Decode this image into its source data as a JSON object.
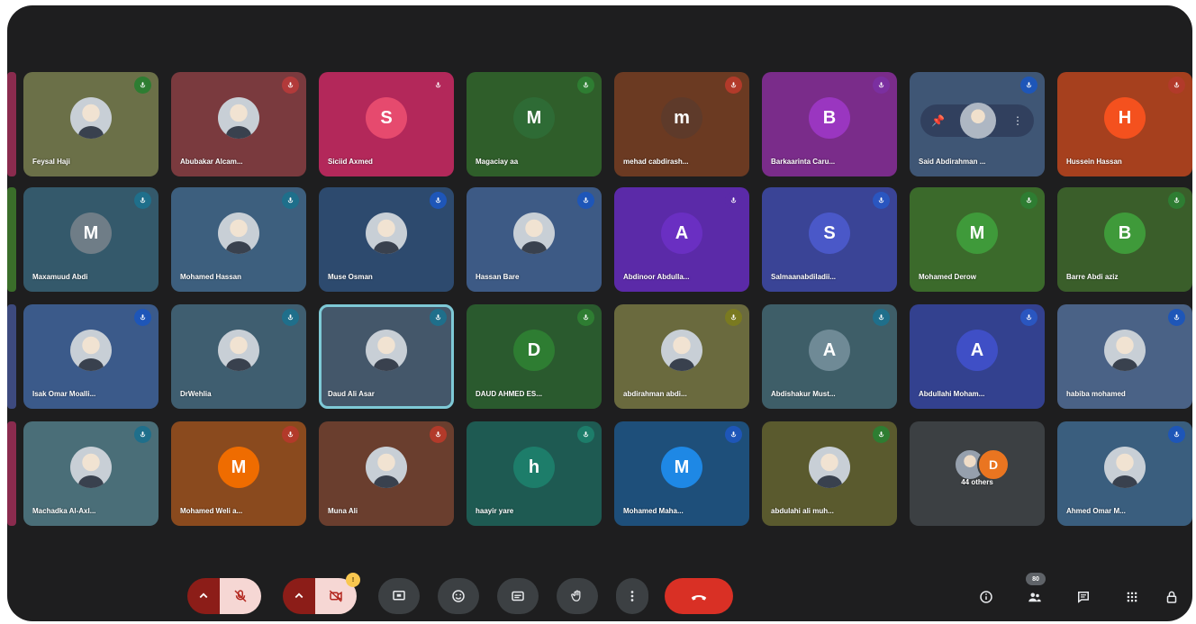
{
  "meeting": {
    "tiles": [
      {
        "name": "Feysal Haji",
        "avatar_type": "photo",
        "bg": "#6b7048",
        "mic_color": "#2e7d32"
      },
      {
        "name": "Abubakar Alcam...",
        "avatar_type": "photo",
        "bg": "#7a3a3e",
        "mic_color": "#b23a3a"
      },
      {
        "name": "Siciid Axmed",
        "avatar_letter": "S",
        "avatar_color": "#e64a6e",
        "bg": "#b3285a",
        "mic_color": "#b3285a"
      },
      {
        "name": "Magaciay aa",
        "avatar_letter": "M",
        "avatar_color": "#2e6b35",
        "bg": "#2f5e2a",
        "mic_color": "#2e7d32"
      },
      {
        "name": "mehad cabdirash...",
        "avatar_letter": "m",
        "avatar_color": "#5e3a2a",
        "bg": "#6b3a22",
        "mic_color": "#b23a2a"
      },
      {
        "name": "Barkaarinta Caru...",
        "avatar_letter": "B",
        "avatar_color": "#9a36c0",
        "bg": "#7a2c8a",
        "mic_color": "#7b2fa0"
      },
      {
        "name": "Said Abdirahman ...",
        "avatar_type": "pinned",
        "bg": "#3f5675",
        "mic_color": "#1e56b8"
      },
      {
        "name": "Hussein Hassan",
        "avatar_letter": "H",
        "avatar_color": "#f4511e",
        "bg": "#a6401e",
        "mic_color": "#b23a2a"
      },
      {
        "name": "Maxamuud Abdi",
        "avatar_letter": "M",
        "avatar_color": "#6f7d87",
        "bg": "#34596b",
        "mic_color": "#1f6f8b"
      },
      {
        "name": "Mohamed Hassan",
        "avatar_type": "photo",
        "bg": "#3d5f7e",
        "mic_color": "#1f6f8b"
      },
      {
        "name": "Muse Osman",
        "avatar_type": "photo",
        "bg": "#2d4a6e",
        "mic_color": "#1e56b8"
      },
      {
        "name": "Hassan Bare",
        "avatar_type": "photo",
        "bg": "#3d5a85",
        "mic_color": "#1e56b8"
      },
      {
        "name": "Abdinoor Abdulla...",
        "avatar_letter": "A",
        "avatar_color": "#6a2fc2",
        "bg": "#5b2aa8",
        "mic_color": "#5b2aa8"
      },
      {
        "name": "Salmaanabdiladii...",
        "avatar_letter": "S",
        "avatar_color": "#4a58c8",
        "bg": "#3a4496",
        "mic_color": "#2a56c0"
      },
      {
        "name": "Mohamed Derow",
        "avatar_letter": "M",
        "avatar_color": "#3f9a3a",
        "bg": "#3b6a2b",
        "mic_color": "#2e7d32"
      },
      {
        "name": "Barre Abdi aziz",
        "avatar_letter": "B",
        "avatar_color": "#3f9a3a",
        "bg": "#3a5e2a",
        "mic_color": "#2e7d32"
      },
      {
        "name": "Isak Omar Moalli...",
        "avatar_type": "photo",
        "bg": "#3b5a8a",
        "mic_color": "#1e56b8"
      },
      {
        "name": "DrWehlia",
        "avatar_type": "photo",
        "bg": "#3f5e70",
        "mic_color": "#1f6f8b"
      },
      {
        "name": "Daud Ali Asar",
        "avatar_type": "photo",
        "bg": "#44576a",
        "mic_color": "#1f6f8b",
        "speaking": true
      },
      {
        "name": "DAUD AHMED ES...",
        "avatar_letter": "D",
        "avatar_color": "#2e7d32",
        "bg": "#2a5a2e",
        "mic_color": "#2e7d32"
      },
      {
        "name": "abdirahman abdi...",
        "avatar_type": "photo",
        "bg": "#6a6a3e",
        "mic_color": "#7a7a20"
      },
      {
        "name": "Abdishakur Must...",
        "avatar_letter": "A",
        "avatar_color": "#6f8a96",
        "bg": "#3e5e68",
        "mic_color": "#1f6f8b"
      },
      {
        "name": "Abdullahi Moham...",
        "avatar_letter": "A",
        "avatar_color": "#3f4fc6",
        "bg": "#33418f",
        "mic_color": "#2a56c0"
      },
      {
        "name": "habiba mohamed",
        "avatar_type": "photo",
        "bg": "#4a6286",
        "mic_color": "#1e56b8"
      },
      {
        "name": "Machadka Al-Axl...",
        "avatar_type": "photo",
        "bg": "#4a6e78",
        "mic_color": "#1f6f8b"
      },
      {
        "name": "Mohamed Weli a...",
        "avatar_letter": "M",
        "avatar_color": "#ef6c00",
        "bg": "#8a4a1e",
        "mic_color": "#b23a2a"
      },
      {
        "name": "Muna Ali",
        "avatar_type": "photo",
        "bg": "#6a3e2e",
        "mic_color": "#b23a2a"
      },
      {
        "name": "haayir yare",
        "avatar_letter": "h",
        "avatar_color": "#1d7d6a",
        "bg": "#1e5a52",
        "mic_color": "#1d7d6a"
      },
      {
        "name": "Mohamed Maha...",
        "avatar_letter": "M",
        "avatar_color": "#1e88e5",
        "bg": "#1e4f7a",
        "mic_color": "#1e56b8"
      },
      {
        "name": "abdulahi ali muh...",
        "avatar_type": "photo",
        "bg": "#5a5a2e",
        "mic_color": "#2e7d32"
      },
      {
        "name": "44 others",
        "avatar_type": "others",
        "other_letter": "D",
        "bg": "#3c4043",
        "mic_color": ""
      },
      {
        "name": "Ahmed Omar M...",
        "avatar_type": "photo",
        "bg": "#3a5e7e",
        "mic_color": "#1e56b8"
      }
    ],
    "edge_colors": [
      "#8a2b4e",
      "#3a6e2a",
      "#3d4a7e",
      "#8a2b4e"
    ]
  },
  "controls": {
    "participant_count": "80",
    "camera_badge": "!",
    "accent_red": "#d93025",
    "dark_red": "#8c1d18",
    "icons": [
      "chevron-up-icon",
      "mic-off-icon",
      "chevron-up-icon",
      "camera-off-icon",
      "present-icon",
      "emoji-icon",
      "captions-icon",
      "raise-hand-icon",
      "more-icon",
      "end-call-icon",
      "info-icon",
      "people-icon",
      "chat-icon",
      "activities-icon",
      "lock-icon"
    ]
  }
}
